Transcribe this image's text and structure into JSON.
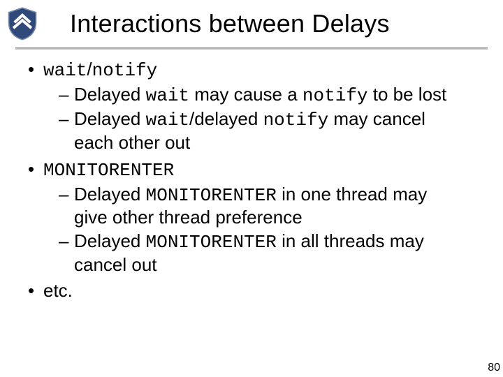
{
  "header": {
    "title": "Interactions between Delays"
  },
  "bullets": {
    "b1": {
      "p1": "wait",
      "slash": "/",
      "p2": "notify",
      "sub": {
        "s1": {
          "t1": "Delayed ",
          "c1": "wait",
          "t2": " may cause a ",
          "c2": "notify",
          "t3": " to be lost"
        },
        "s2": {
          "t1": "Delayed ",
          "c1": "wait",
          "t2": "/delayed ",
          "c2": "notify",
          "t3": " may cancel each other out"
        }
      }
    },
    "b2": {
      "p1": "MONITORENTER",
      "sub": {
        "s1": {
          "t1": "Delayed ",
          "c1": "MONITORENTER",
          "t2": " in one thread may give other thread preference"
        },
        "s2": {
          "t1": "Delayed ",
          "c1": "MONITORENTER",
          "t2": " in all threads may cancel out"
        }
      }
    },
    "b3": {
      "p1": "etc."
    }
  },
  "footer": {
    "page": "80"
  }
}
